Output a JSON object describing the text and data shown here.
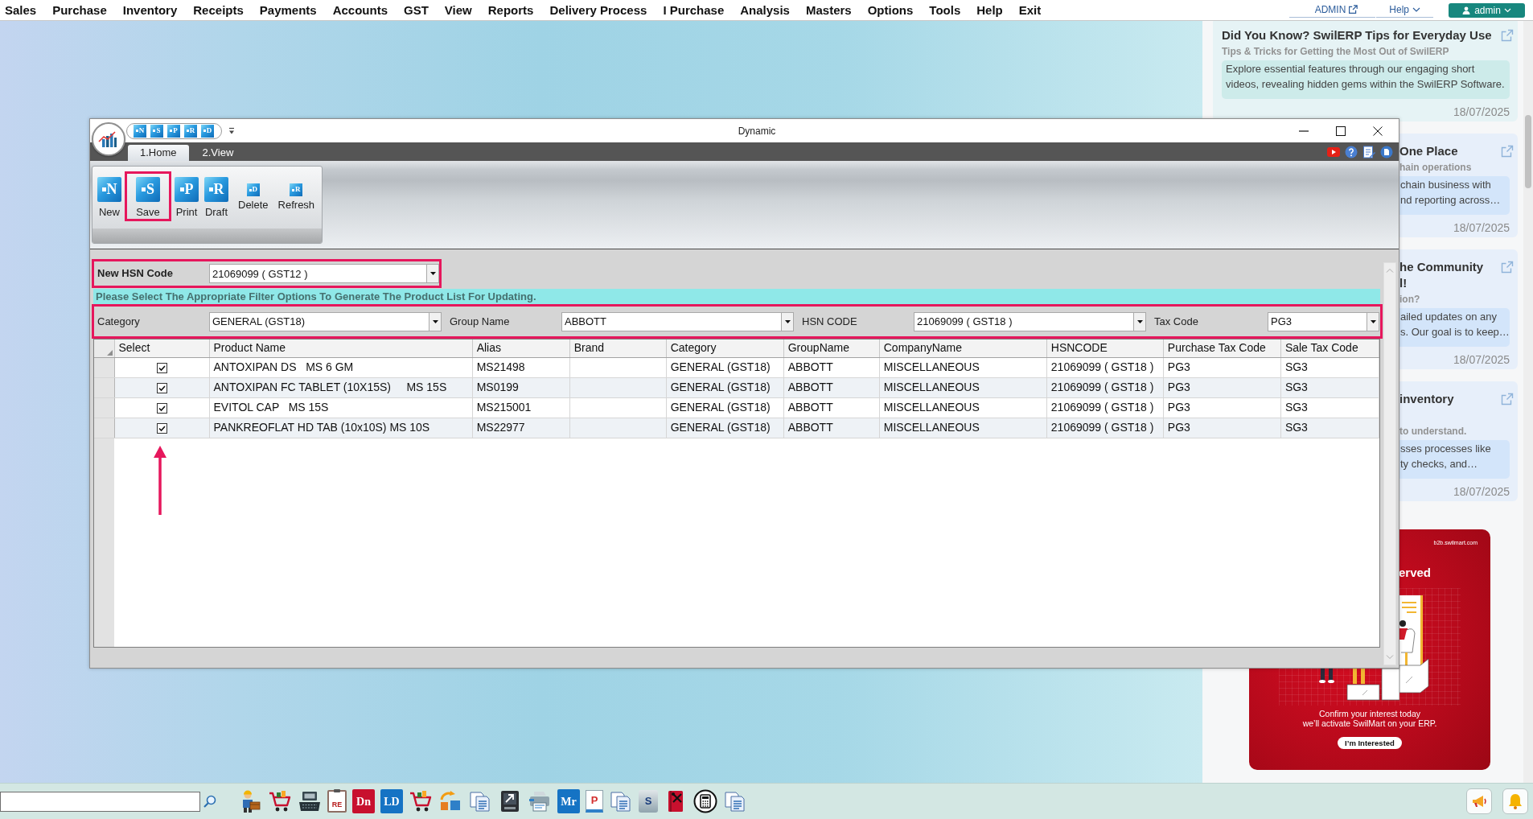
{
  "menu_bar": {
    "items": [
      "Sales",
      "Purchase",
      "Inventory",
      "Receipts",
      "Payments",
      "Accounts",
      "GST",
      "View",
      "Reports",
      "Delivery Process",
      "I Purchase",
      "Analysis",
      "Masters",
      "Options",
      "Tools",
      "Help",
      "Exit"
    ],
    "admin_link": "ADMIN",
    "help": "Help",
    "user": "admin"
  },
  "dialog": {
    "title": "Dynamic",
    "quick_access": [
      {
        "glyph": "N"
      },
      {
        "glyph": "S"
      },
      {
        "glyph": "P"
      },
      {
        "glyph": "R"
      },
      {
        "glyph": "D"
      }
    ],
    "tabs": [
      {
        "label": "1.Home",
        "selected": true
      },
      {
        "label": "2.View",
        "selected": false
      }
    ],
    "ribbon": [
      {
        "label": "New",
        "glyph": "N",
        "kind": "large",
        "highlighted": false
      },
      {
        "label": "Save",
        "glyph": "S",
        "kind": "large",
        "highlighted": true
      },
      {
        "label": "Print",
        "glyph": "P",
        "kind": "large",
        "highlighted": false
      },
      {
        "label": "Draft",
        "glyph": "R",
        "kind": "large",
        "highlighted": false
      },
      {
        "label": "Delete",
        "glyph": "D",
        "kind": "small",
        "highlighted": false
      },
      {
        "label": "Refresh",
        "glyph": "R",
        "kind": "small",
        "highlighted": false
      }
    ],
    "new_hsn": {
      "label": "New HSN Code",
      "value": "21069099 ( GST12 )",
      "highlighted": true
    },
    "notice": "Please Select The Appropriate Filter Options To Generate The Product List For Updating.",
    "filters": {
      "highlighted": true,
      "fields": [
        {
          "label": "Category",
          "value": "GENERAL (GST18)"
        },
        {
          "label": "Group Name",
          "value": "ABBOTT"
        },
        {
          "label": "HSN CODE",
          "value": "21069099 ( GST18 )"
        },
        {
          "label": "Tax Code",
          "value": "PG3"
        }
      ]
    },
    "grid": {
      "pointer_arrow": true,
      "columns": [
        "Select",
        "Product Name",
        "Alias",
        "Brand",
        "Category",
        "GroupName",
        "CompanyName",
        "HSNCODE",
        "Purchase Tax Code",
        "Sale Tax Code"
      ],
      "rows": [
        {
          "checked": true,
          "product_name": "ANTOXIPAN DS   MS 6 GM",
          "alias": "MS21498",
          "category": "GENERAL (GST18)",
          "group_name": "ABBOTT",
          "company_name": "MISCELLANEOUS",
          "hsn_code": "21069099 ( GST18 )",
          "purchase_tax_code": "PG3",
          "sale_tax_code": "SG3"
        },
        {
          "checked": true,
          "product_name": "ANTOXIPAN FC TABLET (10X15S)     MS 15S",
          "alias": "MS0199",
          "category": "GENERAL (GST18)",
          "group_name": "ABBOTT",
          "company_name": "MISCELLANEOUS",
          "hsn_code": "21069099 ( GST18 )",
          "purchase_tax_code": "PG3",
          "sale_tax_code": "SG3"
        },
        {
          "checked": true,
          "product_name": "EVITOL CAP   MS 15S",
          "alias": "MS215001",
          "category": "GENERAL (GST18)",
          "group_name": "ABBOTT",
          "company_name": "MISCELLANEOUS",
          "hsn_code": "21069099 ( GST18 )",
          "purchase_tax_code": "PG3",
          "sale_tax_code": "SG3"
        },
        {
          "checked": true,
          "product_name": "PANKREOFLAT HD TAB (10x10S) MS 10S",
          "alias": "MS22977",
          "category": "GENERAL (GST18)",
          "group_name": "ABBOTT",
          "company_name": "MISCELLANEOUS",
          "hsn_code": "21069099 ( GST18 )",
          "purchase_tax_code": "PG3",
          "sale_tax_code": "SG3"
        }
      ]
    }
  },
  "news": [
    {
      "kind": "full",
      "title_lines": [
        "Did You Know? SwilERP Tips for Everyday Use"
      ],
      "subtitle_lines": [
        "Tips & Tricks for Getting the Most Out of SwilERP"
      ],
      "body": "Explore essential features through our engaging short videos, revealing hidden gems within the SwilERP Software.",
      "date": "18/07/2025"
    },
    {
      "kind": "partial",
      "title_lines": [
        "One Place"
      ],
      "subtitle_lines": [
        "hain operations"
      ],
      "body_lines": [
        "chain business with",
        "nd reporting across…"
      ],
      "date": "18/07/2025"
    },
    {
      "kind": "partial",
      "title_lines": [
        "he Community",
        "l!"
      ],
      "subtitle_lines": [
        "ion?"
      ],
      "body_lines": [
        "ailed updates on any",
        "s. Our goal is to keep…"
      ],
      "date": "18/07/2025"
    },
    {
      "kind": "partial",
      "title_lines": [
        "inventory"
      ],
      "subtitle_lines": [
        "to understand."
      ],
      "body_lines": [
        "sses processes like",
        "ty checks, and…"
      ],
      "date": "18/07/2025"
    }
  ],
  "promo": {
    "site": "b2b.swilmart.com",
    "headline": "erved",
    "lines": [
      "Confirm your interest today",
      "we’ll activate SwilMart on your ERP."
    ],
    "button": "I’m Interested"
  },
  "taskbar": {
    "apps": [
      {
        "kind": "worker"
      },
      {
        "kind": "cart"
      },
      {
        "kind": "register"
      },
      {
        "kind": "clipboard",
        "glyph": "RE"
      },
      {
        "kind": "tile",
        "glyph": "Dn",
        "color": "#c8102e"
      },
      {
        "kind": "tile",
        "glyph": "LD",
        "color": "#1573c4"
      },
      {
        "kind": "cart"
      },
      {
        "kind": "exchange"
      },
      {
        "kind": "documents"
      },
      {
        "kind": "device"
      },
      {
        "kind": "printer"
      },
      {
        "kind": "tile",
        "glyph": "Mr",
        "color": "#1573c4"
      },
      {
        "kind": "page",
        "glyph": "P"
      },
      {
        "kind": "documents"
      },
      {
        "kind": "stack",
        "glyph": "S"
      },
      {
        "kind": "book"
      },
      {
        "kind": "calculator"
      },
      {
        "kind": "documents"
      }
    ],
    "tray": [
      {
        "kind": "megaphone"
      },
      {
        "kind": "bell"
      }
    ]
  }
}
